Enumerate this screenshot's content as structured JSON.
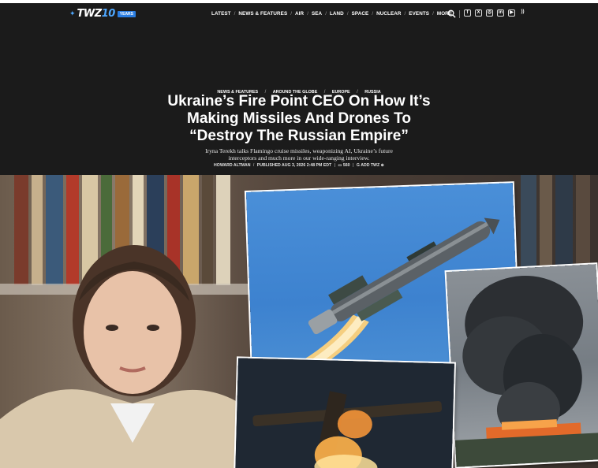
{
  "nav": {
    "logo": {
      "text": "TWZ",
      "years": "10",
      "badge": "YEARS"
    },
    "menu": [
      {
        "label": "LATEST"
      },
      {
        "label": "NEWS & FEATURES"
      },
      {
        "label": "AIR"
      },
      {
        "label": "SEA"
      },
      {
        "label": "LAND"
      },
      {
        "label": "SPACE"
      },
      {
        "label": "NUCLEAR"
      },
      {
        "label": "EVENTS"
      },
      {
        "label": "MORE"
      }
    ],
    "social": [
      {
        "icon": "facebook-icon",
        "glyph": "f"
      },
      {
        "icon": "x-icon",
        "glyph": "X"
      },
      {
        "icon": "instagram-icon",
        "glyph": "◎"
      },
      {
        "icon": "linkedin-icon",
        "glyph": "in"
      },
      {
        "icon": "youtube-icon",
        "glyph": "▶"
      },
      {
        "icon": "rss-icon",
        "glyph": "))"
      }
    ]
  },
  "article": {
    "breadcrumbs": [
      {
        "label": "NEWS & FEATURES"
      },
      {
        "label": "AROUND THE GLOBE"
      },
      {
        "label": "EUROPE"
      },
      {
        "label": "RUSSIA"
      }
    ],
    "headline": {
      "line1": "Ukraine’s Fire Point CEO On How It’s",
      "line2": "Making Missiles And Drones To",
      "line3": "“Destroy The Russian Empire”"
    },
    "dek": {
      "line1": "Iryna Terekh talks Flamingo cruise missiles, weaponizing AI, Ukraine’s future",
      "line2": "interceptors and much more in our wide-ranging interview."
    },
    "byline": {
      "author": "HOWARD ALTMAN",
      "published": "PUBLISHED AUG 3, 2026 2:48 PM EDT",
      "comments": "560",
      "add": "ADD TWZ"
    }
  },
  "colors": {
    "nav_bg": "#1b1b1b",
    "accent": "#2a7de1"
  }
}
